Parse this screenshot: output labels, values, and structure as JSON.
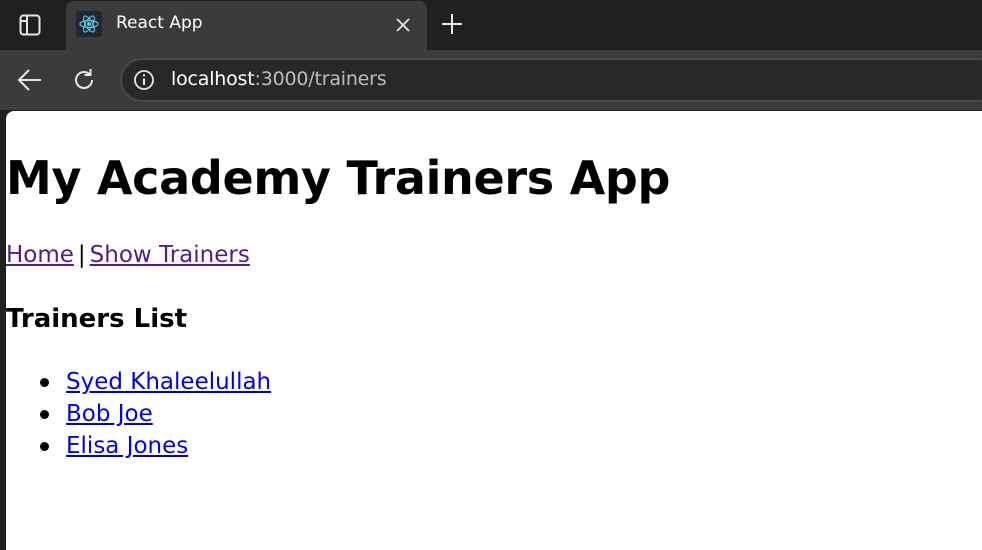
{
  "browser": {
    "tab": {
      "title": "React App",
      "favicon": "react-logo-icon"
    },
    "url": {
      "host": "localhost",
      "path": ":3000/trainers"
    },
    "icons": {
      "tab_actions": "tab-actions-icon",
      "close": "close-icon",
      "new_tab": "plus-icon",
      "back": "back-arrow-icon",
      "reload": "reload-icon",
      "info": "info-icon"
    }
  },
  "page": {
    "title": "My Academy Trainers App",
    "nav": {
      "home_label": "Home",
      "separator": "|",
      "show_trainers_label": "Show Trainers"
    },
    "section_title": "Trainers List",
    "trainers": [
      {
        "name": "Syed Khaleelullah"
      },
      {
        "name": "Bob Joe"
      },
      {
        "name": "Elisa Jones"
      }
    ]
  },
  "colors": {
    "visited_link": "#551a8b",
    "link": "#0000ee",
    "chrome_dark": "#202020",
    "toolbar": "#3b3b3b"
  }
}
